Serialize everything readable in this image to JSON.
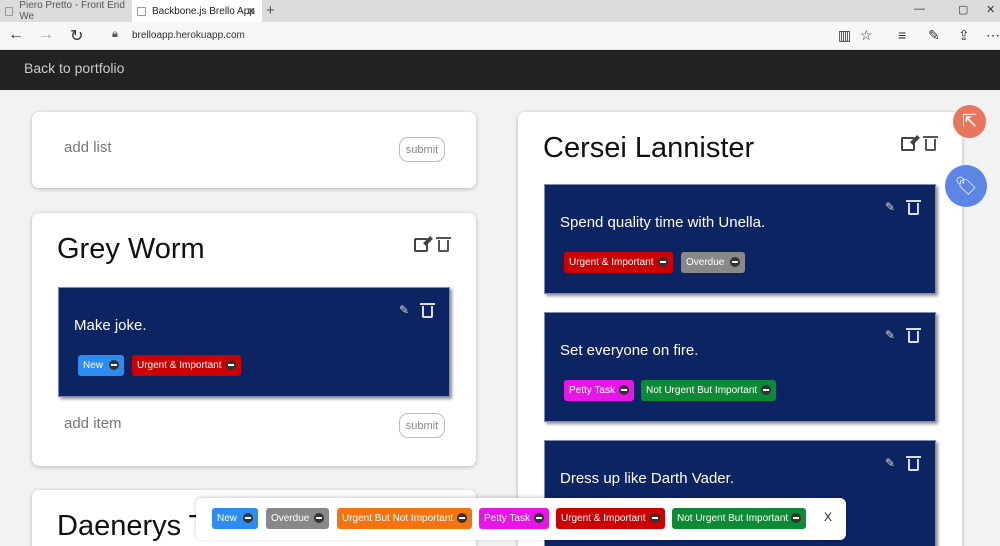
{
  "browser": {
    "tabs": [
      {
        "title": "Piero Pretto - Front End We"
      },
      {
        "title": "Backbone.js Brello App"
      }
    ],
    "url": "brelloapp.herokuapp.com"
  },
  "header": {
    "back_link": "Back to portfolio"
  },
  "add_list": {
    "placeholder": "add list",
    "submit_label": "submit"
  },
  "lists": [
    {
      "title": "Grey Worm",
      "add_item_placeholder": "add item",
      "submit_label": "submit",
      "items": [
        {
          "text": "Make joke.",
          "tags": [
            "New",
            "Urgent & Important"
          ]
        }
      ]
    },
    {
      "title": "Cersei Lannister",
      "items": [
        {
          "text": "Spend quality time with Unella.",
          "tags": [
            "Urgent & Important",
            "Overdue"
          ]
        },
        {
          "text": "Set everyone on fire.",
          "tags": [
            "Petty Task",
            "Not Urgent But Important"
          ]
        },
        {
          "text": "Dress up like Darth Vader.",
          "tags": []
        }
      ]
    },
    {
      "title": "Daenerys T"
    }
  ],
  "tag_bar": {
    "tags": [
      "New",
      "Overdue",
      "Urgent But Not Important",
      "Petty Task",
      "Urgent & Important",
      "Not Urgent But Important"
    ],
    "close_label": "X"
  },
  "tag_colors": {
    "New": "#2d8cf0",
    "Overdue": "#888888",
    "Urgent But Not Important": "#f5730f",
    "Petty Task": "#e815e8",
    "Urgent & Important": "#cc0000",
    "Not Urgent But Important": "#0c8a35"
  }
}
